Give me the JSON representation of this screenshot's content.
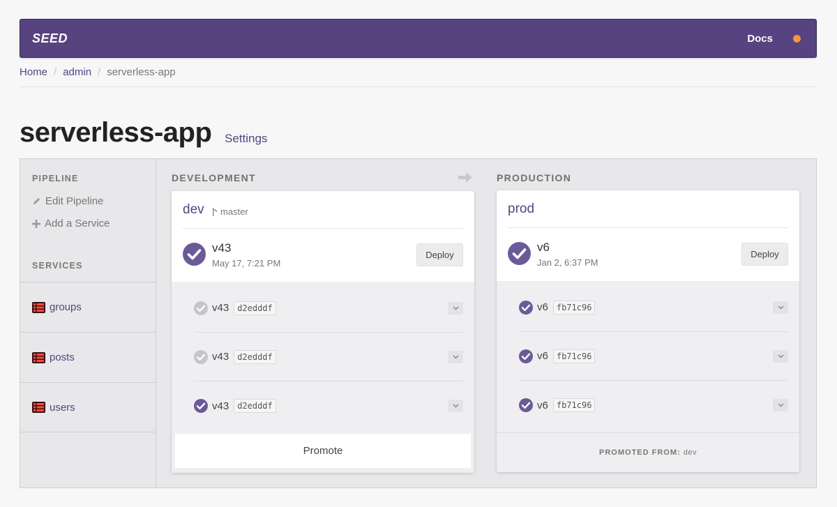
{
  "navbar": {
    "brand": "SEED",
    "docs_label": "Docs",
    "status_dot_color": "#f5953b"
  },
  "breadcrumb": {
    "home": "Home",
    "org": "admin",
    "current": "serverless-app",
    "separator": "/"
  },
  "page": {
    "title": "serverless-app",
    "settings_label": "Settings"
  },
  "sidebar": {
    "pipeline_heading": "PIPELINE",
    "edit_pipeline": "Edit Pipeline",
    "add_service": "Add a Service",
    "services_heading": "SERVICES",
    "services": [
      "groups",
      "posts",
      "users"
    ]
  },
  "stages": [
    {
      "heading": "DEVELOPMENT",
      "name": "dev",
      "branch": "master",
      "latest": {
        "version": "v43",
        "date": "May 17, 7:21 PM",
        "status": "success"
      },
      "deploy_label": "Deploy",
      "builds": [
        {
          "version": "v43",
          "commit": "d2edddf",
          "status": "inactive"
        },
        {
          "version": "v43",
          "commit": "d2edddf",
          "status": "inactive"
        },
        {
          "version": "v43",
          "commit": "d2edddf",
          "status": "success"
        }
      ],
      "promote_label": "Promote"
    },
    {
      "heading": "PRODUCTION",
      "name": "prod",
      "latest": {
        "version": "v6",
        "date": "Jan 2, 6:37 PM",
        "status": "success"
      },
      "deploy_label": "Deploy",
      "builds": [
        {
          "version": "v6",
          "commit": "fb71c96",
          "status": "success"
        },
        {
          "version": "v6",
          "commit": "fb71c96",
          "status": "success"
        },
        {
          "version": "v6",
          "commit": "fb71c96",
          "status": "success"
        }
      ],
      "promoted_from_label": "PROMOTED FROM:",
      "promoted_from_stage": "dev"
    }
  ],
  "colors": {
    "accent": "#56437f",
    "success_check": "#6b5a98",
    "inactive_check": "#c6c6c9"
  },
  "icons": {
    "pipeline_arrow": "arrow-right-icon",
    "edit": "pencil-icon",
    "add": "plus-icon",
    "service": "service-stack-icon",
    "branch": "branch-icon",
    "expand": "chevron-down-icon"
  }
}
